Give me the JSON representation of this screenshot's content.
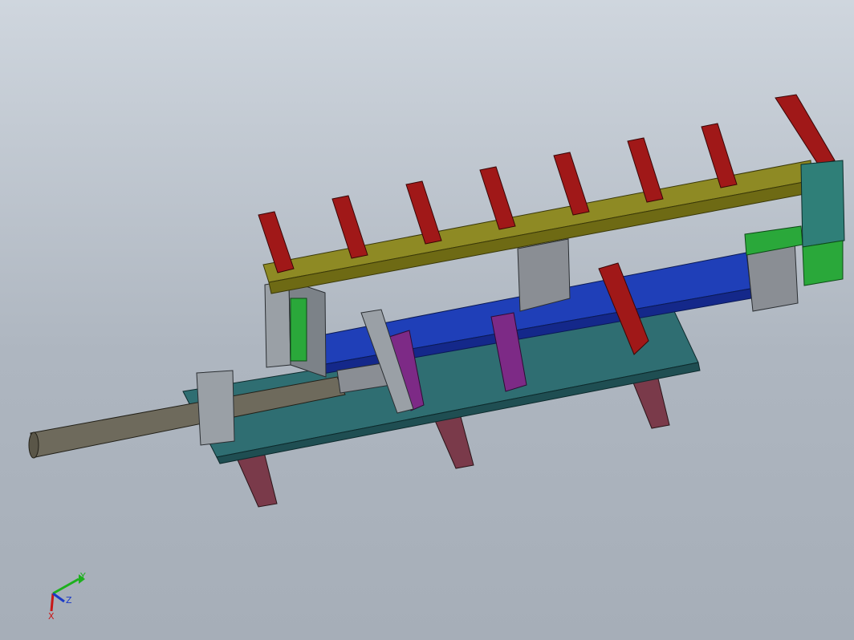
{
  "colors": {
    "background_top": "#cfd6de",
    "background_bottom": "#a6aeb8",
    "base_plate": "#2f6e72",
    "blue_rail": "#1f3fb8",
    "olive_bar": "#8e8a24",
    "red_fingers": "#a01818",
    "legs": "#7a3a4a",
    "purple_blocks": "#7d2a86",
    "green_block": "#2aa83a",
    "teal_bracket": "#2f7f78",
    "gray_parts": "#8a8e94",
    "cylinder_rod": "#6e6a5c"
  },
  "triad": {
    "x_label": "X",
    "y_label": "Y",
    "z_label": "Z"
  }
}
